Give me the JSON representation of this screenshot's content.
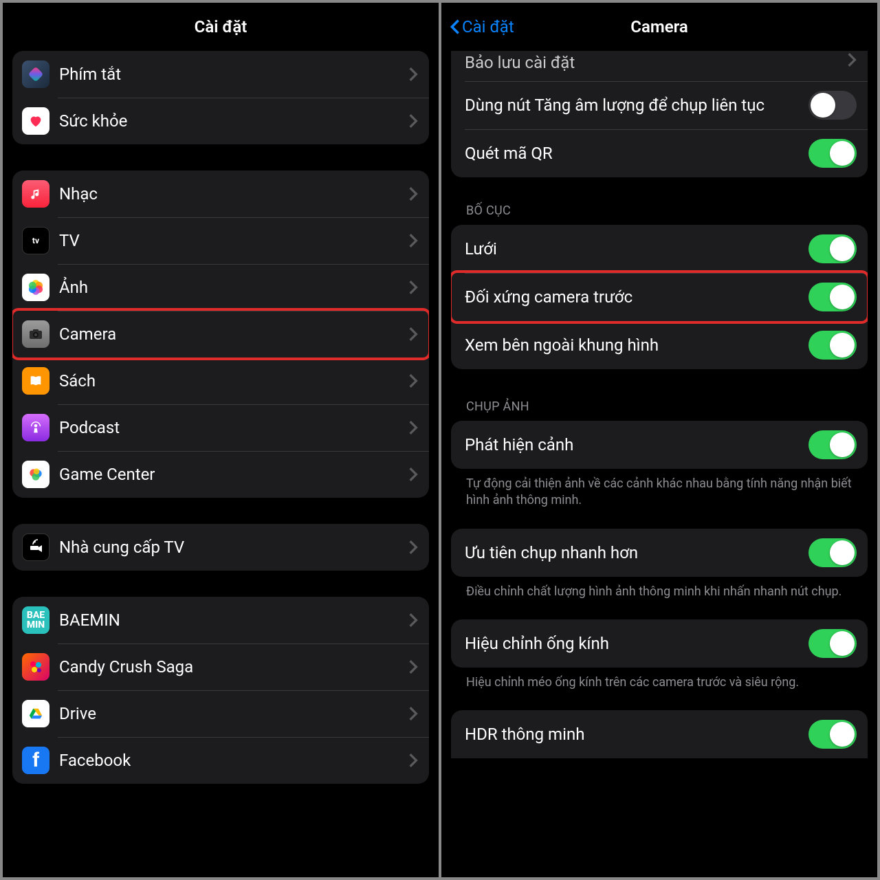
{
  "left": {
    "title": "Cài đặt",
    "groups": [
      {
        "items": [
          {
            "id": "shortcuts",
            "label": "Phím tắt",
            "icon": "shortcuts"
          },
          {
            "id": "health",
            "label": "Sức khỏe",
            "icon": "health"
          }
        ]
      },
      {
        "items": [
          {
            "id": "music",
            "label": "Nhạc",
            "icon": "music"
          },
          {
            "id": "tv",
            "label": "TV",
            "icon": "tv"
          },
          {
            "id": "photos",
            "label": "Ảnh",
            "icon": "photos"
          },
          {
            "id": "camera",
            "label": "Camera",
            "icon": "camera",
            "highlight": true
          },
          {
            "id": "books",
            "label": "Sách",
            "icon": "books"
          },
          {
            "id": "podcast",
            "label": "Podcast",
            "icon": "podcast"
          },
          {
            "id": "gamecenter",
            "label": "Game Center",
            "icon": "gamecenter"
          }
        ]
      },
      {
        "items": [
          {
            "id": "tvprovider",
            "label": "Nhà cung cấp TV",
            "icon": "tvprovider"
          }
        ]
      },
      {
        "items": [
          {
            "id": "baemin",
            "label": "BAEMIN",
            "icon": "baemin"
          },
          {
            "id": "candy",
            "label": "Candy Crush Saga",
            "icon": "candy"
          },
          {
            "id": "drive",
            "label": "Drive",
            "icon": "drive"
          },
          {
            "id": "facebook",
            "label": "Facebook",
            "icon": "facebook"
          }
        ]
      }
    ]
  },
  "right": {
    "back": "Cài đặt",
    "title": "Camera",
    "top_partial": {
      "rows": [
        {
          "id": "preserve",
          "label": "Bảo lưu cài đặt",
          "type": "link"
        },
        {
          "id": "volumeup",
          "label": "Dùng nút Tăng âm lượng để chụp liên tục",
          "type": "switch",
          "on": false
        },
        {
          "id": "qr",
          "label": "Quét mã QR",
          "type": "switch",
          "on": true
        }
      ]
    },
    "sections": [
      {
        "header": "BỐ CỤC",
        "rows": [
          {
            "id": "grid",
            "label": "Lưới",
            "type": "switch",
            "on": true
          },
          {
            "id": "mirror",
            "label": "Đối xứng camera trước",
            "type": "switch",
            "on": true,
            "highlight": true
          },
          {
            "id": "outside",
            "label": "Xem bên ngoài khung hình",
            "type": "switch",
            "on": true
          }
        ]
      },
      {
        "header": "CHỤP ẢNH",
        "rows": [
          {
            "id": "scene",
            "label": "Phát hiện cảnh",
            "type": "switch",
            "on": true
          }
        ],
        "footer": "Tự động cải thiện ảnh về các cảnh khác nhau bằng tính năng nhận biết hình ảnh thông minh."
      },
      {
        "rows": [
          {
            "id": "faster",
            "label": "Ưu tiên chụp nhanh hơn",
            "type": "switch",
            "on": true
          }
        ],
        "footer": "Điều chỉnh chất lượng hình ảnh thông minh khi nhấn nhanh nút chụp."
      },
      {
        "rows": [
          {
            "id": "lens",
            "label": "Hiệu chỉnh ống kính",
            "type": "switch",
            "on": true
          }
        ],
        "footer": "Hiệu chỉnh méo ống kính trên các camera trước và siêu rộng."
      },
      {
        "rows": [
          {
            "id": "hdr",
            "label": "HDR thông minh",
            "type": "switch",
            "on": true
          }
        ]
      }
    ]
  }
}
